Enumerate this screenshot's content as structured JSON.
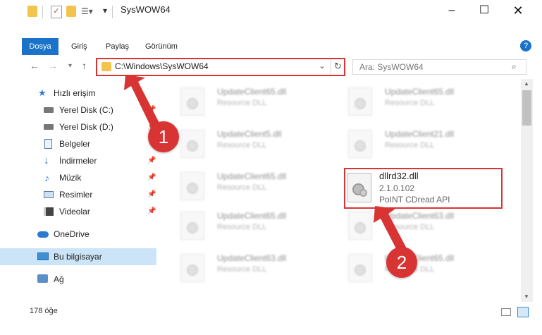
{
  "window": {
    "title": "SysWOW64"
  },
  "ribbon": {
    "tabs": [
      "Dosya",
      "Giriş",
      "Paylaş",
      "Görünüm"
    ]
  },
  "address": {
    "path": "C:\\Windows\\SysWOW64"
  },
  "search": {
    "placeholder": "Ara: SysWOW64"
  },
  "sidebar": {
    "items": [
      {
        "label": "Hızlı erişim",
        "icon": "star-icon"
      },
      {
        "label": "Yerel Disk (C:)",
        "icon": "drive-icon"
      },
      {
        "label": "Yerel Disk (D:)",
        "icon": "drive-icon"
      },
      {
        "label": "Belgeler",
        "icon": "document-icon"
      },
      {
        "label": "İndirmeler",
        "icon": "download-icon"
      },
      {
        "label": "Müzik",
        "icon": "music-icon"
      },
      {
        "label": "Resimler",
        "icon": "pictures-icon"
      },
      {
        "label": "Videolar",
        "icon": "video-icon"
      },
      {
        "label": "OneDrive",
        "icon": "cloud-icon"
      },
      {
        "label": "Bu bilgisayar",
        "icon": "computer-icon"
      },
      {
        "label": "Ağ",
        "icon": "network-icon"
      }
    ]
  },
  "files": {
    "left": [
      {
        "name": "UpdateClient65.dll",
        "desc": "Resource DLL"
      },
      {
        "name": "UpdateClient5.dll",
        "desc": "Resource DLL"
      },
      {
        "name": "UpdateClient65.dll",
        "desc": "Resource DLL"
      },
      {
        "name": "UpdateClient65.dll",
        "desc": "Resource DLL"
      },
      {
        "name": "UpdateClient63.dll",
        "desc": "Resource DLL"
      }
    ],
    "right": [
      {
        "name": "UpdateClient65.dll",
        "desc": "Resource DLL"
      },
      {
        "name": "UpdateClient21.dll",
        "desc": "Resource DLL"
      },
      {
        "name": "UpdateClient63.dll",
        "desc": "Resource DLL"
      },
      {
        "name": "UpdateClient65.dll",
        "desc": "Resource DLL"
      }
    ],
    "highlighted": {
      "name": "dllrd32.dll",
      "version": "2.1.0.102",
      "desc": "PoINT CDread API"
    }
  },
  "status": {
    "count": "178 öğe"
  },
  "callouts": {
    "one": "1",
    "two": "2"
  },
  "colors": {
    "accent": "#1a73c8",
    "highlight": "#d93434"
  }
}
